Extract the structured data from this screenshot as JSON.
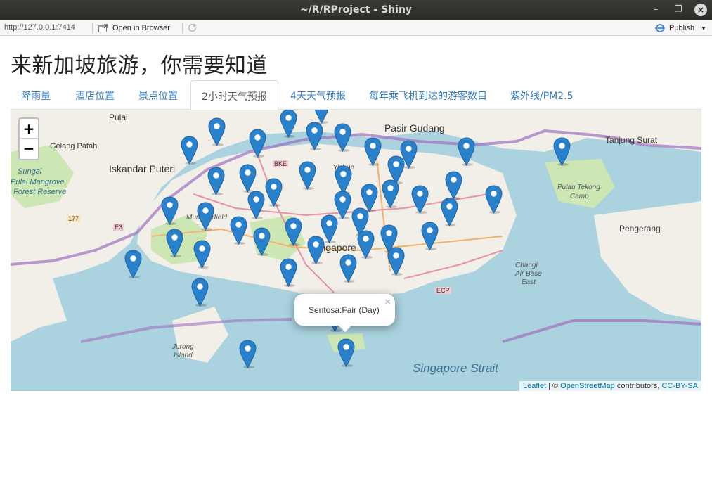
{
  "window": {
    "title": "~/R/RProject - Shiny"
  },
  "toolbar": {
    "url": "http://127.0.0.1:7414",
    "open_label": "Open in Browser",
    "publish_label": "Publish"
  },
  "page": {
    "title": "来新加坡旅游，你需要知道"
  },
  "tabs": [
    {
      "label": "降雨量"
    },
    {
      "label": "酒店位置"
    },
    {
      "label": "景点位置"
    },
    {
      "label": "2小时天气预报",
      "active": true
    },
    {
      "label": "4天天气预报"
    },
    {
      "label": "每年乘飞机到达的游客数目"
    },
    {
      "label": "紫外线/PM2.5"
    }
  ],
  "map": {
    "zoom_in": "+",
    "zoom_out": "−",
    "labels": {
      "pulai": "Pulai",
      "pasir_gudang": "Pasir Gudang",
      "tanjung_surat": "Tanjung Surat",
      "gelang_patah": "Gelang Patah",
      "iskandar_puteri": "Iskandar Puteri",
      "sungai": "Sungai",
      "pulai_mangrove": "Pulai Mangrove",
      "forest_reserve": "Forest Reserve",
      "pulau_tekong": "Pulau Tekong",
      "camp": "Camp",
      "pengerang": "Pengerang",
      "murai_airfield": "Murai Airfield",
      "singapore": "Singapore",
      "changi": "Changi",
      "air_base": "Air Base",
      "east": "East",
      "jurong": "Jurong",
      "island": "Island",
      "singapore_strait": "Singapore Strait",
      "yishun": "Yishun",
      "bke": "BKE",
      "ecp": "ECP",
      "e3": "E3",
      "r177": "177"
    },
    "popup_text": "Sentosa:Fair (Day)",
    "popup_close": "×",
    "attribution": {
      "leaflet": "Leaflet",
      "sep": " | © ",
      "osm": "OpenStreetMap",
      "contrib": " contributors, ",
      "license": "CC-BY-SA"
    }
  },
  "colors": {
    "water": "#aad3df",
    "land": "#f2efe9",
    "park": "#cde7b4",
    "marker": "#2a81cb",
    "boundary": "#9e6fc0",
    "link": "#337ab7"
  }
}
